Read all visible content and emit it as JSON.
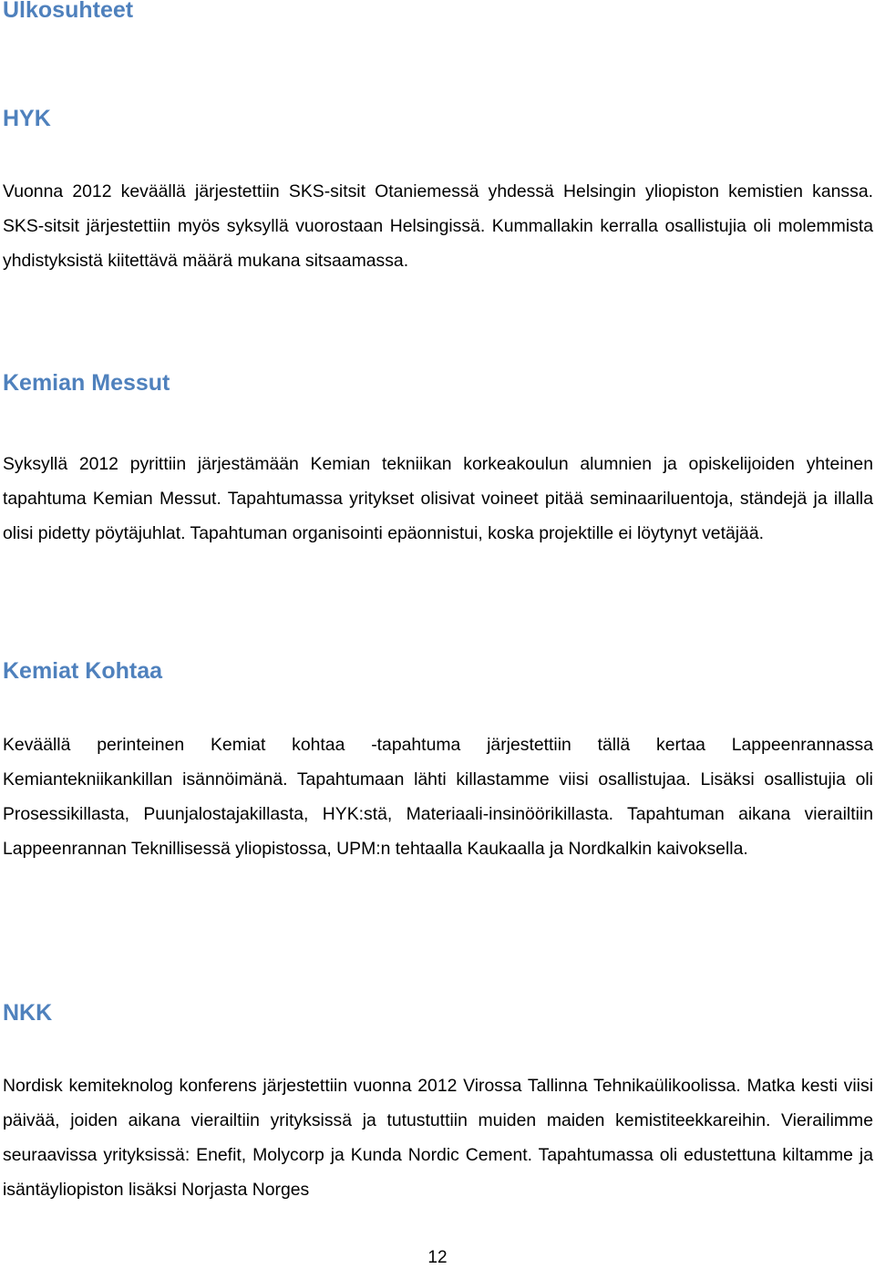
{
  "document": {
    "title": "Ulkosuhteet",
    "heading_color": "#4F81BD",
    "sections": [
      {
        "heading": "HYK",
        "body": "Vuonna 2012 keväällä järjestettiin SKS-sitsit Otaniemessä yhdessä Helsingin yliopiston kemistien kanssa. SKS-sitsit järjestettiin myös syksyllä vuorostaan Helsingissä. Kummallakin kerralla osallistujia oli molemmista yhdistyksistä kiitettävä määrä mukana sitsaamassa."
      },
      {
        "heading": "Kemian Messut",
        "body": "Syksyllä 2012 pyrittiin järjestämään Kemian tekniikan korkeakoulun alumnien ja opiskelijoiden yhteinen tapahtuma Kemian Messut. Tapahtumassa yritykset olisivat voineet pitää seminaariluentoja, ständejä ja illalla olisi pidetty pöytäjuhlat. Tapahtuman organisointi epäonnistui, koska projektille ei löytynyt vetäjää."
      },
      {
        "heading": "Kemiat Kohtaa",
        "body": "Keväällä perinteinen Kemiat kohtaa -tapahtuma järjestettiin tällä kertaa Lappeenrannassa Kemiantekniikankillan isännöimänä. Tapahtumaan lähti killastamme viisi osallistujaa. Lisäksi osallistujia oli Prosessikillasta, Puunjalostajakillasta, HYK:stä, Materiaali-insinöörikillasta. Tapahtuman aikana vierailtiin Lappeenrannan Teknillisessä yliopistossa, UPM:n tehtaalla Kaukaalla ja Nordkalkin kaivoksella."
      },
      {
        "heading": "NKK",
        "body": "Nordisk kemiteknolog konferens järjestettiin vuonna 2012 Virossa Tallinna Tehnikaülikoolissa. Matka kesti viisi päivää, joiden aikana vierailtiin yrityksissä ja tutustuttiin muiden maiden kemistiteekkareihin. Vierailimme seuraavissa yrityksissä: Enefit, Molycorp ja Kunda Nordic Cement. Tapahtumassa oli edustettuna kiltamme ja isäntäyliopiston lisäksi Norjasta Norges"
      }
    ],
    "page_number": "12"
  }
}
